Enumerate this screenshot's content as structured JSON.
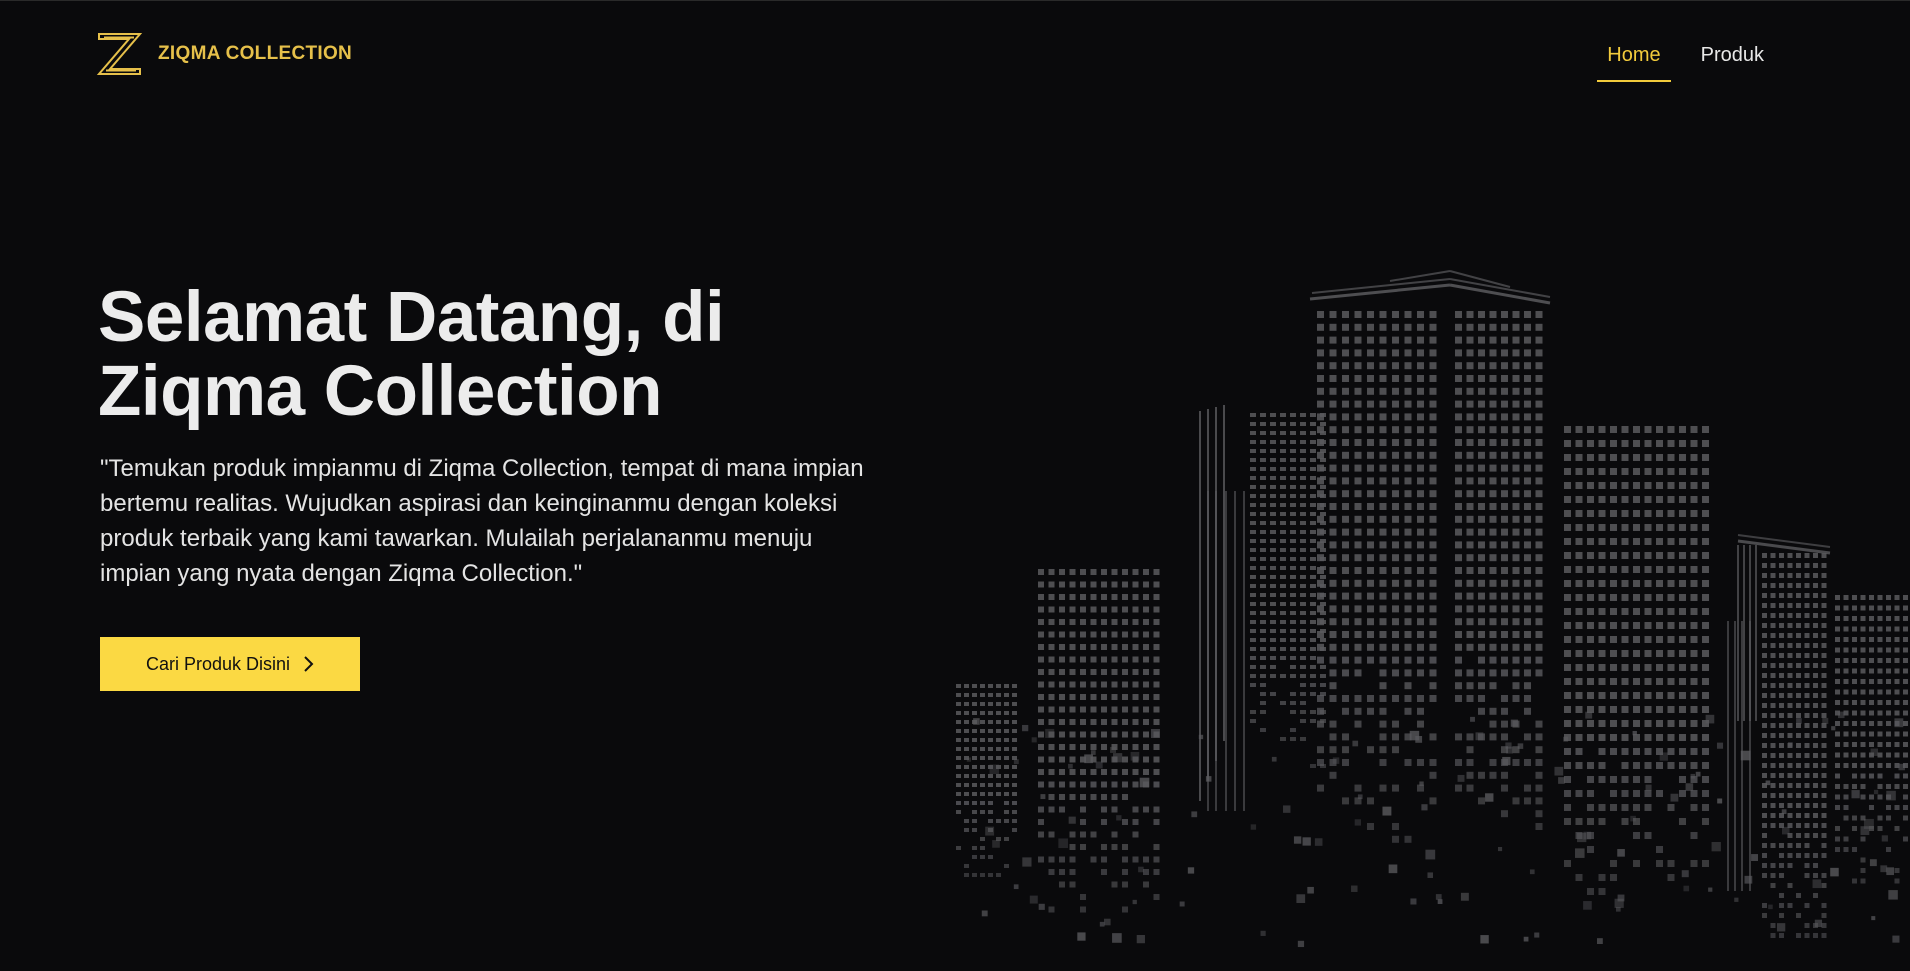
{
  "brand": {
    "logo_icon": "z-monogram-logo",
    "name": "ZIQMA COLLECTION"
  },
  "nav": {
    "items": [
      {
        "label": "Home",
        "active": true
      },
      {
        "label": "Produk",
        "active": false
      }
    ]
  },
  "hero": {
    "title_line1": "Selamat Datang, di",
    "title_line2": "Ziqma Collection",
    "description": "\"Temukan produk impianmu di Ziqma Collection, tempat di mana impian bertemu realitas. Wujudkan aspirasi dan keinginanmu dengan koleksi produk terbaik yang kami tawarkan. Mulailah perjalananmu menuju impian yang nyata dengan Ziqma Collection.\"",
    "cta_label": "Cari Produk Disini",
    "cta_icon": "chevron-right-icon"
  },
  "illustration": {
    "name": "city-skyline-illustration"
  },
  "colors": {
    "background": "#0a0a0c",
    "accent": "#fbd943",
    "brand_gold": "#e6c04a",
    "text": "#ececec",
    "building": "#5a5a5e"
  }
}
